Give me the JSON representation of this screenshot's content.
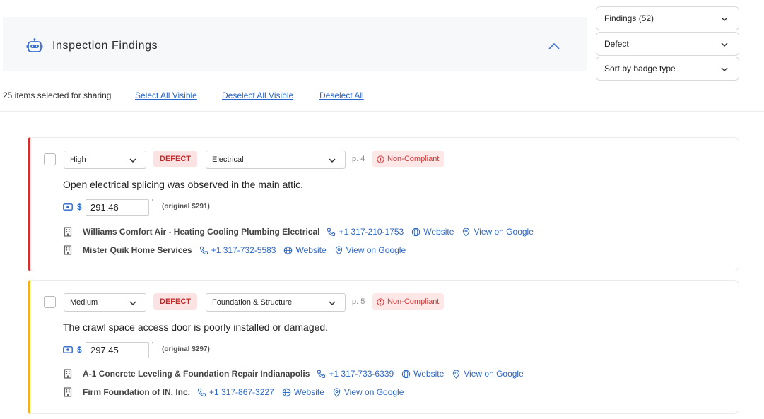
{
  "header": {
    "title": "Inspection Findings"
  },
  "filters": {
    "findings": "Findings (52)",
    "badge_type": "Defect",
    "sort": "Sort by badge type"
  },
  "share_bar": {
    "selected_text": "25 items selected for sharing",
    "select_all_visible": "Select All Visible",
    "deselect_all_visible": "Deselect All Visible",
    "deselect_all": "Deselect All"
  },
  "colors": {
    "high_accent": "#d32f2f",
    "medium_accent": "#f2b21a",
    "link": "#2b66c8"
  },
  "findings": [
    {
      "severity": "High",
      "badge": "DEFECT",
      "category": "Electrical",
      "page": "p. 4",
      "compliance": "Non-Compliant",
      "description": "Open electrical splicing was observed in the main attic.",
      "price": "291.46",
      "original": "(original $291)",
      "contractors": [
        {
          "name": "Williams Comfort Air - Heating Cooling Plumbing Electrical",
          "phone": "+1 317-210-1753",
          "website": "Website",
          "google": "View on Google"
        },
        {
          "name": "Mister Quik Home Services",
          "phone": "+1 317-732-5583",
          "website": "Website",
          "google": "View on Google"
        }
      ]
    },
    {
      "severity": "Medium",
      "badge": "DEFECT",
      "category": "Foundation & Structure",
      "page": "p. 5",
      "compliance": "Non-Compliant",
      "description": "The crawl space access door is poorly installed or damaged.",
      "price": "297.45",
      "original": "(original $297)",
      "contractors": [
        {
          "name": "A-1 Concrete Leveling & Foundation Repair Indianapolis",
          "phone": "+1 317-733-6339",
          "website": "Website",
          "google": "View on Google"
        },
        {
          "name": "Firm Foundation of IN, Inc.",
          "phone": "+1 317-867-3227",
          "website": "Website",
          "google": "View on Google"
        }
      ]
    }
  ]
}
